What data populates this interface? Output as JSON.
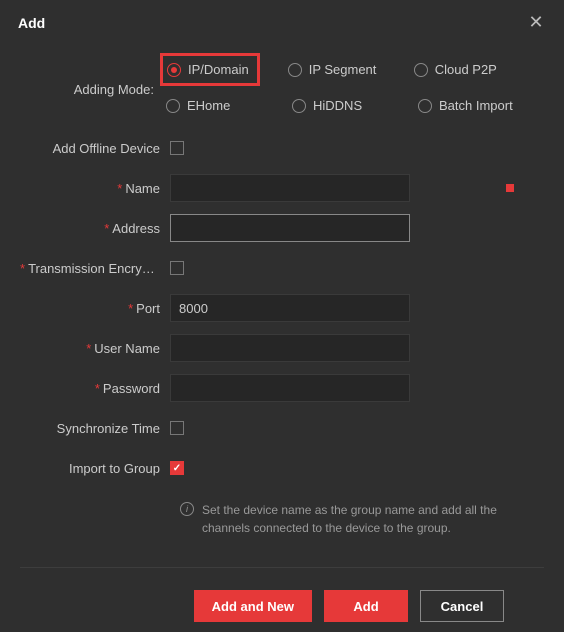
{
  "dialog": {
    "title": "Add"
  },
  "labels": {
    "adding_mode": "Adding Mode:",
    "add_offline_device": "Add Offline Device",
    "name": "Name",
    "address": "Address",
    "transmission_encryption": "Transmission Encrypti...",
    "port": "Port",
    "user_name": "User Name",
    "password": "Password",
    "synchronize_time": "Synchronize Time",
    "import_to_group": "Import to Group"
  },
  "radios": {
    "ip_domain": "IP/Domain",
    "ip_segment": "IP Segment",
    "cloud_p2p": "Cloud P2P",
    "ehome": "EHome",
    "hiddns": "HiDDNS",
    "batch_import": "Batch Import"
  },
  "values": {
    "name": "",
    "address": "",
    "port": "8000",
    "user_name": "",
    "password": ""
  },
  "checkboxes": {
    "add_offline_device": false,
    "transmission_encryption": false,
    "synchronize_time": false,
    "import_to_group": true
  },
  "info": {
    "text": "Set the device name as the group name and add all the channels connected to the device to the group."
  },
  "buttons": {
    "add_and_new": "Add and New",
    "add": "Add",
    "cancel": "Cancel"
  }
}
